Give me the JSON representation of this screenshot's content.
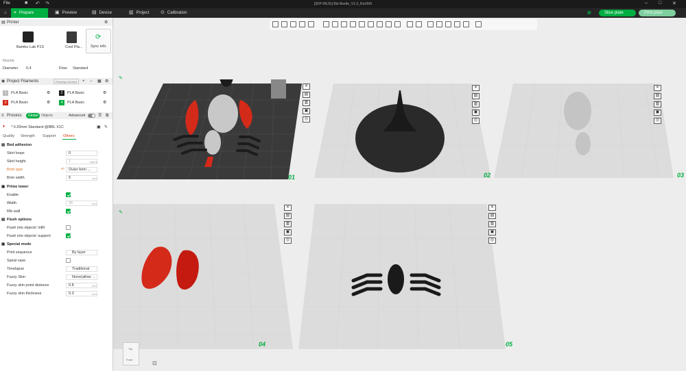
{
  "window": {
    "title": "[3DP RKJG] Bib Beetle_V1.0_RuXMS",
    "file_menu": "File"
  },
  "tabs": [
    {
      "label": "Prepare",
      "icon": "prepare-icon"
    },
    {
      "label": "Preview",
      "icon": "preview-icon"
    },
    {
      "label": "Device",
      "icon": "device-icon"
    },
    {
      "label": "Project",
      "icon": "project-icon"
    },
    {
      "label": "Calibration",
      "icon": "calibration-icon"
    }
  ],
  "actions": {
    "slice": "Slice plate",
    "print": "Print plate"
  },
  "printer": {
    "section": "Printer",
    "name": "Bambu Lab P1S",
    "plate": "Cool Pla...",
    "sync": "Sync info",
    "nozzle_label": "Nozzle",
    "diameter_label": "Diameter",
    "diameter_value": "0.4",
    "flow_label": "Flow",
    "flow_value": "Standard"
  },
  "filaments": {
    "section": "Project Filaments",
    "flushing": "Flushing volumes",
    "items": [
      {
        "num": "1",
        "name": "PLA Basic",
        "color": "#d8d8d8"
      },
      {
        "num": "2",
        "name": "PLA Basic",
        "color": "#1a1a1a"
      },
      {
        "num": "3",
        "name": "PLA Basic",
        "color": "#d42a1a"
      },
      {
        "num": "4",
        "name": "PLA Basic",
        "color": "#00ae42"
      }
    ]
  },
  "process": {
    "section": "Process",
    "toggle_global": "Global",
    "toggle_objects": "Objects",
    "advanced": "Advanced",
    "profile": "* 0.20mm Standard @BBL X1C",
    "subtabs": [
      "Quality",
      "Strength",
      "Support",
      "Others"
    ],
    "active_subtab": "Others"
  },
  "settings": {
    "bed_adhesion": "Bed adhesion",
    "skirt_loops_label": "Skirt loops",
    "skirt_loops": "0",
    "skirt_height_label": "Skirt height",
    "skirt_height": "1",
    "skirt_height_unit": "layers",
    "brim_type_label": "Brim type",
    "brim_type": "Outer brim ...",
    "brim_width_label": "Brim width",
    "brim_width": "5",
    "brim_width_unit": "mm",
    "prime_tower": "Prime tower",
    "enable_label": "Enable",
    "width_label": "Width",
    "width": "35",
    "width_unit": "mm",
    "rib_wall_label": "Rib wall",
    "flush_options": "Flush options",
    "flush_infill_label": "Flush into objects' infill",
    "flush_support_label": "Flush into objects' support",
    "special_mode": "Special mode",
    "print_sequence_label": "Print sequence",
    "print_sequence": "By layer",
    "spiral_vase_label": "Spiral vase",
    "timelapse_label": "Timelapse",
    "timelapse": "Traditional",
    "fuzzy_skin_label": "Fuzzy Skin",
    "fuzzy_skin": "None(allow ...",
    "fuzzy_dist_label": "Fuzzy skin point distance",
    "fuzzy_dist": "0.8",
    "fuzzy_dist_unit": "mm",
    "fuzzy_thick_label": "Fuzzy skin thickness",
    "fuzzy_thick": "0.3",
    "fuzzy_thick_unit": "mm"
  },
  "plates": [
    "01",
    "02",
    "03",
    "04",
    "05"
  ],
  "view_cube": {
    "top": "Top",
    "front": "Front"
  },
  "colors": {
    "accent": "#00ae42",
    "red": "#d42a1a"
  }
}
